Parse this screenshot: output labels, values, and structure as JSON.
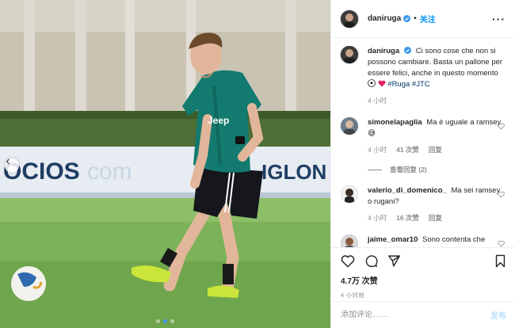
{
  "post": {
    "author": "daniruga",
    "follow_label": "关注",
    "more_label": "···",
    "caption": {
      "username": "daniruga",
      "text": "Ci sono cose che non si possono cambiare. Basta un pallone per essere felici, anche in questo momento ",
      "hashtags": [
        "#Ruga",
        "#JTC"
      ],
      "time": "4 小时"
    },
    "likes": "4.7万 次赞",
    "timestamp": "4 小时前"
  },
  "photo": {
    "banner_left": "OCIOS",
    "banner_mid": "com",
    "banner_right": "IGLON",
    "shirt_sponsor": "Jeep"
  },
  "comments": [
    {
      "username": "simonelapaglia",
      "text": "Ma è uguale a ramsey 😅",
      "time": "4 小时",
      "likes": "41 次赞",
      "reply": "回复"
    },
    {
      "username": "valerio_di_domenico_",
      "text": "Ma sei ramsey o rugani?",
      "time": "4 小时",
      "likes": "16 次赞",
      "reply": "回复"
    },
    {
      "username": "jaime_omar10",
      "text": "Sono contenta che",
      "time": "",
      "likes": "",
      "reply": ""
    }
  ],
  "view_replies": "查看回复 (2)",
  "add_comment": {
    "placeholder": "添加评论……",
    "post_label": "发布"
  },
  "colors": {
    "accent": "#0095f6",
    "like_red": "#ed4956",
    "verified": "#3897f0"
  }
}
